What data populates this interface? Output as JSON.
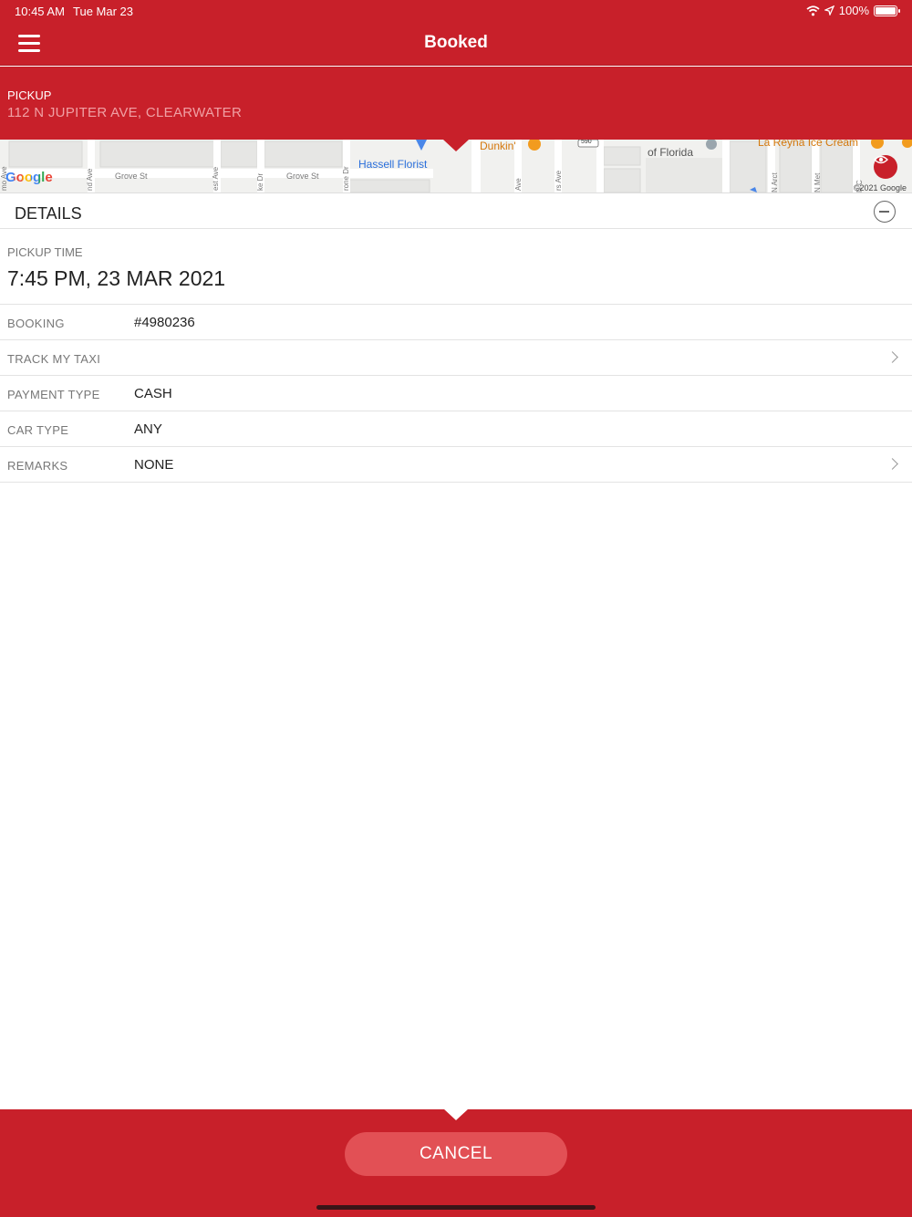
{
  "status_bar": {
    "time": "10:45 AM",
    "date": "Tue Mar 23",
    "battery": "100%",
    "battery_level": 1.0
  },
  "nav": {
    "title": "Booked"
  },
  "pickup": {
    "label": "PICKUP",
    "address": "112 N JUPITER AVE, CLEARWATER"
  },
  "map": {
    "places": [
      "Hassell Florist",
      "Dunkin'",
      "of Florida",
      "La Reyna Ice Cream"
    ],
    "route_shield": "590",
    "streets": [
      "Grove St",
      "Grove St",
      "mo Ave",
      "nd Ave",
      "est Ave",
      "ke Dr",
      "rone Dr",
      "Ave",
      "rs Ave",
      "N Arct",
      "N Met",
      "N C"
    ],
    "logo": "Google",
    "copyright": "©2021 Google"
  },
  "details": {
    "title": "DETAILS",
    "pickup_time_label": "PICKUP TIME",
    "pickup_time": "7:45 PM, 23 MAR 2021",
    "rows": [
      {
        "label": "BOOKING",
        "value": "#4980236"
      },
      {
        "label": "TRACK MY TAXI",
        "value": ""
      },
      {
        "label": "PAYMENT TYPE",
        "value": "CASH"
      },
      {
        "label": "CAR TYPE",
        "value": "ANY"
      },
      {
        "label": "REMARKS",
        "value": "NONE"
      }
    ]
  },
  "footer": {
    "cancel_label": "CANCEL"
  },
  "colors": {
    "brand": "#c8202a",
    "cancel_button": "#e25055",
    "muted_text": "#777777"
  },
  "icons": [
    "hamburger-menu-icon",
    "wifi-icon",
    "location-arrow-icon",
    "battery-icon",
    "eye-icon",
    "collapse-minus-icon",
    "chevron-right-icon"
  ]
}
